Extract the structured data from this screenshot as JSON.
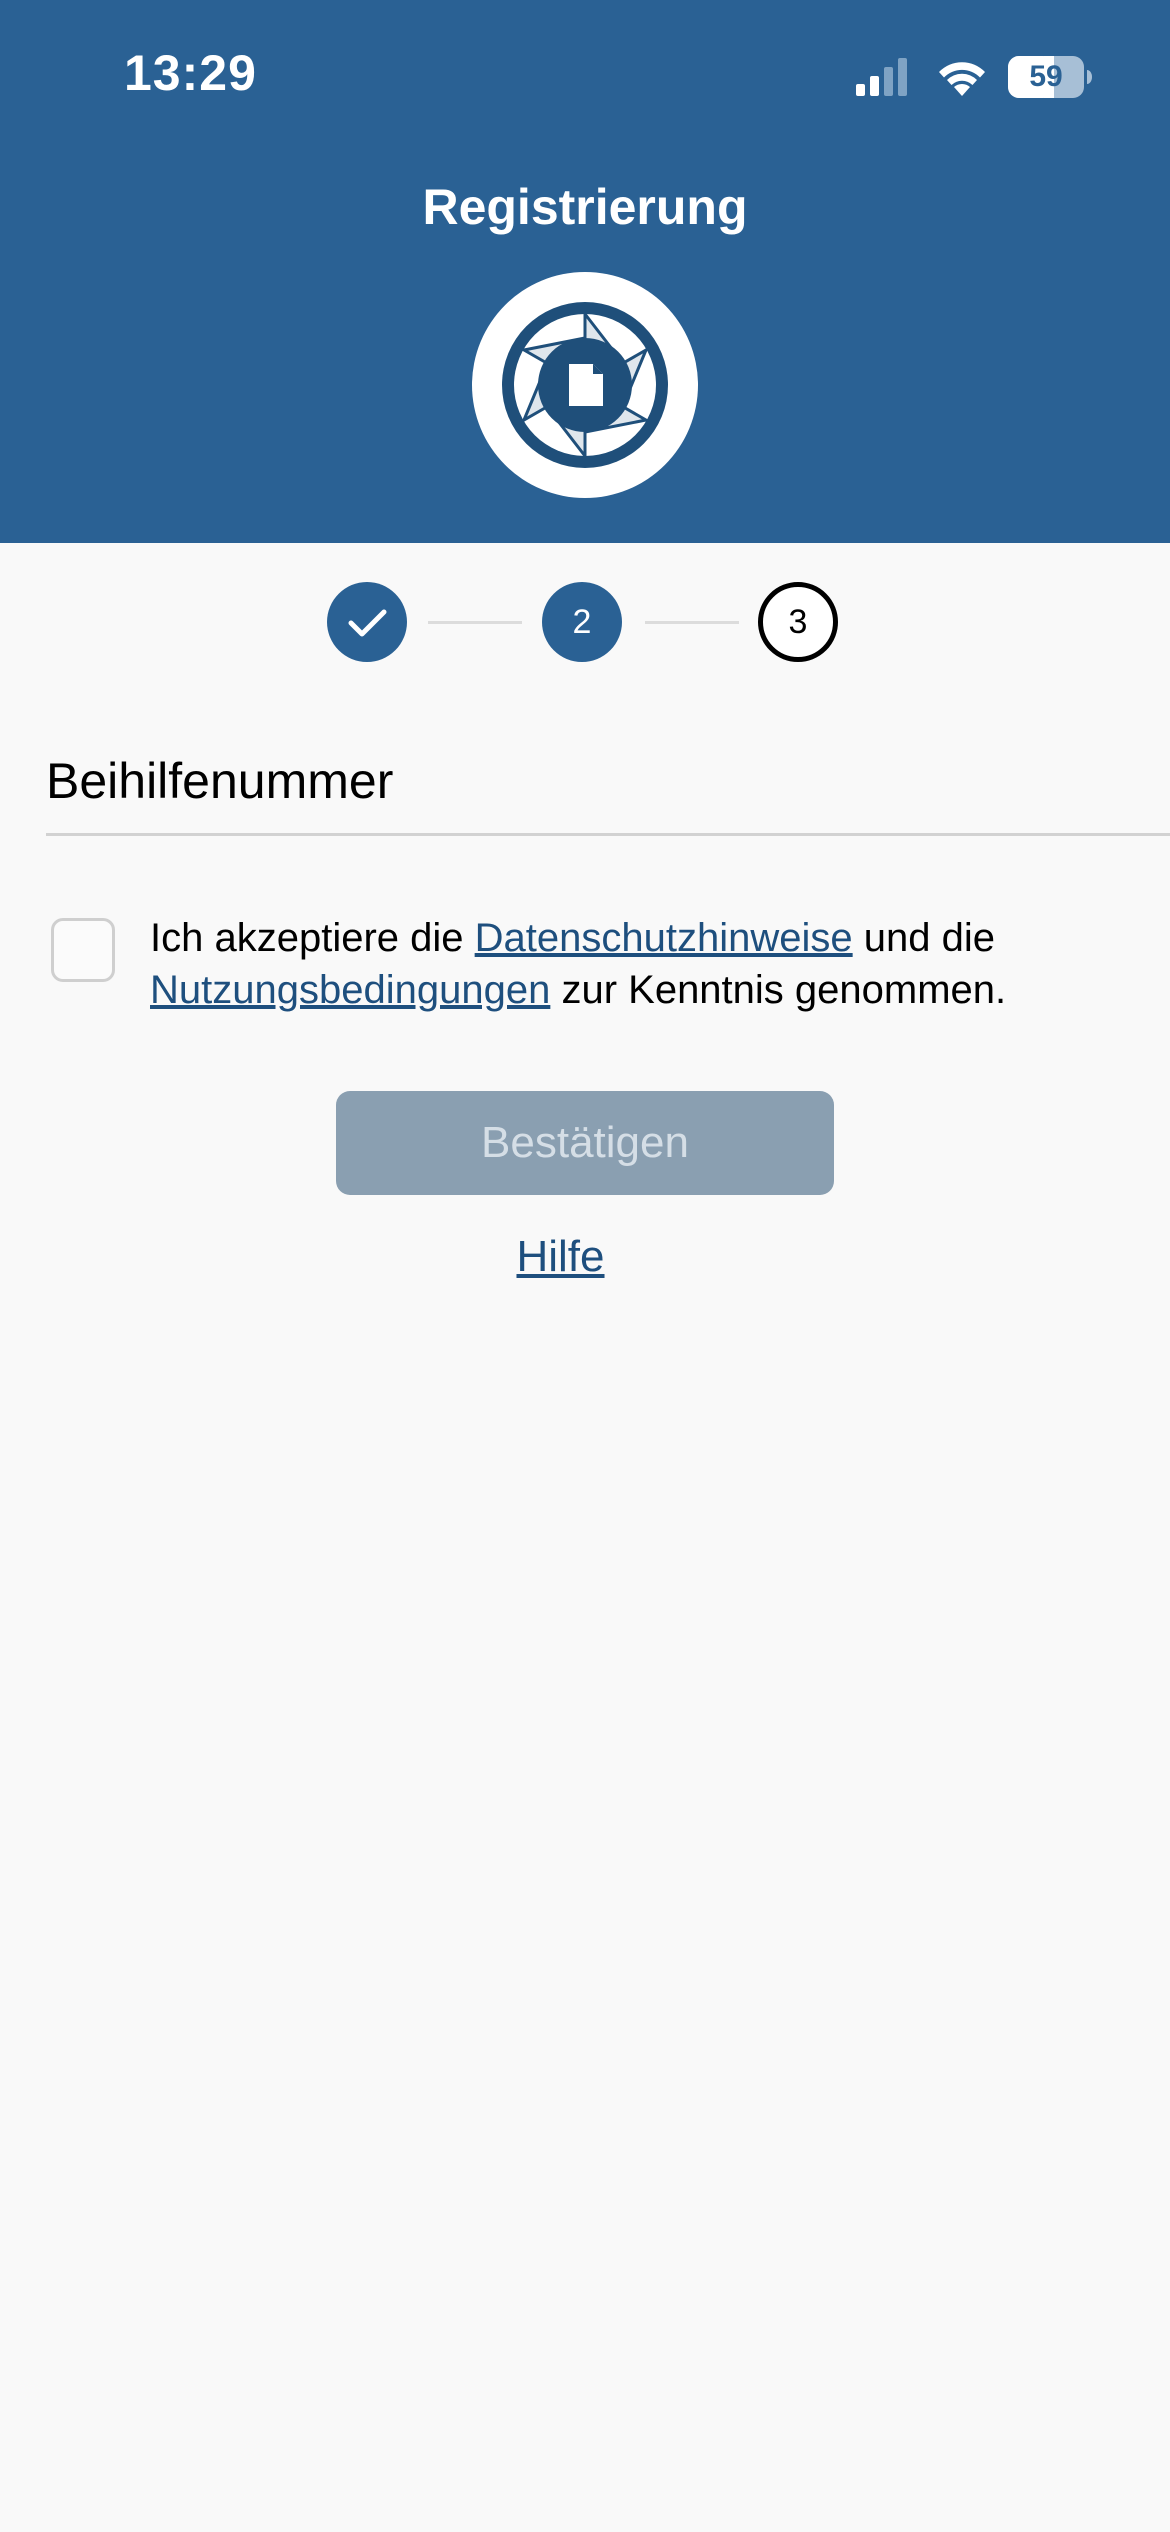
{
  "status_bar": {
    "time": "13:29",
    "battery": "59"
  },
  "header": {
    "title": "Registrierung",
    "logo_icon": "camera-aperture-document-icon",
    "background_color": "#2a6194"
  },
  "stepper": {
    "steps": [
      {
        "label": "",
        "state": "completed",
        "icon": "checkmark-icon"
      },
      {
        "label": "2",
        "state": "current"
      },
      {
        "label": "3",
        "state": "upcoming"
      }
    ]
  },
  "form": {
    "field_label": "Beihilfenummer",
    "consent": {
      "text_before": "Ich akzeptiere die ",
      "link_privacy": "Datenschutzhinweise",
      "text_middle": " und die ",
      "link_terms": "Nutzungsbedingungen",
      "text_after": " zur Kenntnis genommen.",
      "checked": false
    },
    "confirm_label": "Bestätigen",
    "confirm_enabled": false,
    "help_label": "Hilfe"
  },
  "colors": {
    "primary": "#2a6194",
    "link": "#1e4f7e",
    "disabled_button": "#8a9fb1",
    "background": "#f9f9f9"
  }
}
